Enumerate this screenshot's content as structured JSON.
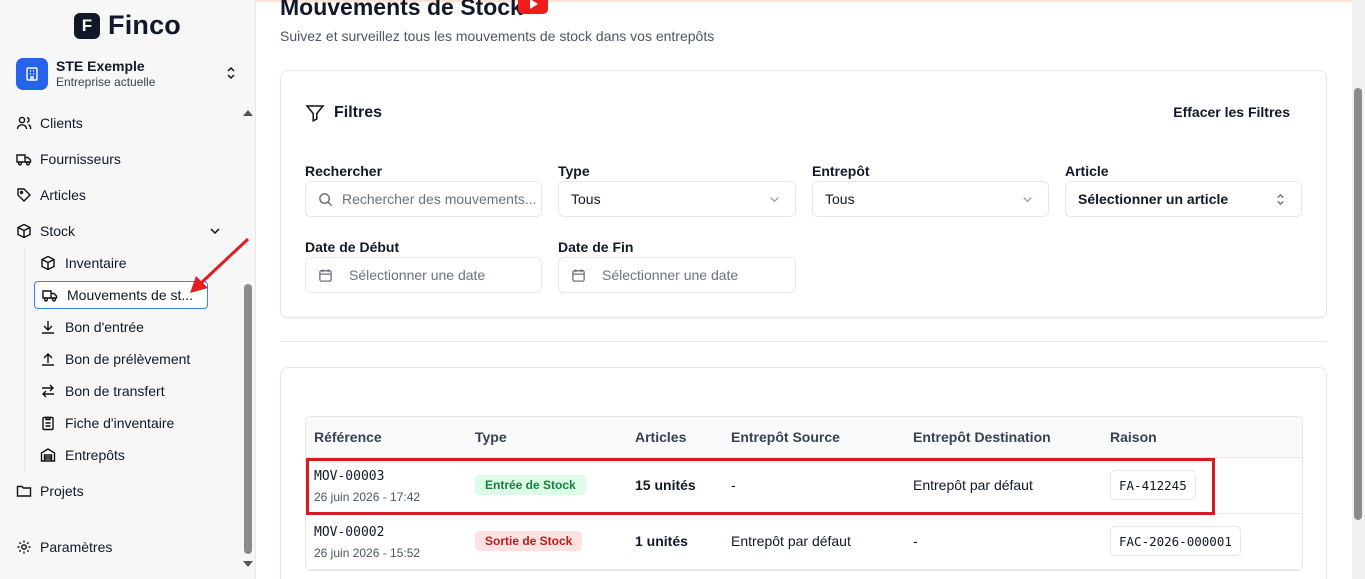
{
  "brand": {
    "name": "Finco",
    "mark": "F"
  },
  "company": {
    "name": "STE Exemple",
    "subtitle": "Entreprise actuelle"
  },
  "nav": {
    "clients": "Clients",
    "fournisseurs": "Fournisseurs",
    "articles": "Articles",
    "stock": "Stock",
    "projets": "Projets",
    "parametres": "Paramètres"
  },
  "stock_sub": {
    "inventaire": "Inventaire",
    "mouvements": "Mouvements de st...",
    "bon_entree": "Bon d'entrée",
    "bon_prelevement": "Bon de prélèvement",
    "bon_transfert": "Bon de transfert",
    "fiche_inventaire": "Fiche d'inventaire",
    "entrepots": "Entrepôts"
  },
  "page": {
    "title": "Mouvements de Stock",
    "subtitle": "Suivez et surveillez tous les mouvements de stock dans vos entrepôts"
  },
  "filters": {
    "title": "Filtres",
    "clear": "Effacer les Filtres",
    "search_label": "Rechercher",
    "search_placeholder": "Rechercher des mouvements...",
    "type_label": "Type",
    "type_value": "Tous",
    "warehouse_label": "Entrepôt",
    "warehouse_value": "Tous",
    "article_label": "Article",
    "article_value": "Sélectionner un article",
    "start_label": "Date de Début",
    "start_placeholder": "Sélectionner une date",
    "end_label": "Date de Fin",
    "end_placeholder": "Sélectionner une date"
  },
  "table": {
    "headers": {
      "reference": "Référence",
      "type": "Type",
      "articles": "Articles",
      "source": "Entrepôt Source",
      "destination": "Entrepôt Destination",
      "raison": "Raison"
    },
    "rows": [
      {
        "reference": "MOV-00003",
        "date": "26 juin 2026 - 17:42",
        "type": "Entrée de Stock",
        "articles": "15 unités",
        "source": "-",
        "destination": "Entrepôt par défaut",
        "raison": "FA-412245"
      },
      {
        "reference": "MOV-00002",
        "date": "26 juin 2026 - 15:52",
        "type": "Sortie de Stock",
        "articles": "1 unités",
        "source": "Entrepôt par défaut",
        "destination": "-",
        "raison": "FAC-2026-000001"
      }
    ]
  },
  "colors": {
    "accent": "#2563eb",
    "highlight": "#d81b22",
    "in_badge": "#dcfce7",
    "out_badge": "#fee2e2"
  }
}
